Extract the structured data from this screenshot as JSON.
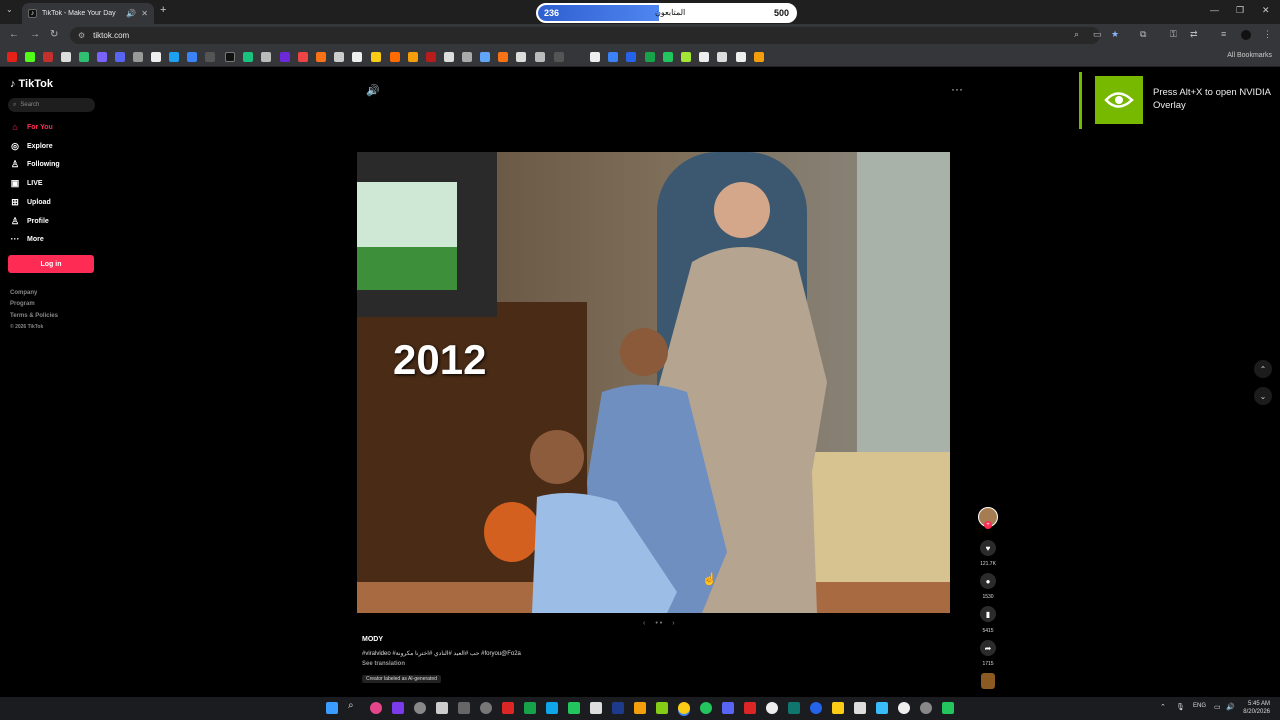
{
  "browser": {
    "tab_title": "TikTok - Make Your Day",
    "url": "tiktok.com",
    "all_bookmarks": "All Bookmarks"
  },
  "overlay_progress": {
    "current": "236",
    "label": "المتابعون",
    "max": "500",
    "fraction": 0.472
  },
  "sidebar": {
    "logo": "TikTok",
    "search_placeholder": "Search",
    "items": [
      {
        "label": "For You",
        "icon": "home-icon",
        "active": true
      },
      {
        "label": "Explore",
        "icon": "compass-icon"
      },
      {
        "label": "Following",
        "icon": "user-icon"
      },
      {
        "label": "LIVE",
        "icon": "live-icon"
      },
      {
        "label": "Upload",
        "icon": "upload-icon"
      },
      {
        "label": "Profile",
        "icon": "profile-icon"
      },
      {
        "label": "More",
        "icon": "more-icon"
      }
    ],
    "login": "Log in",
    "footer": [
      "Company",
      "Program",
      "Terms & Policies",
      "© 2026 TikTok"
    ]
  },
  "post": {
    "year_overlay": "2012",
    "author": "MODY",
    "caption": "#viralvideo #حب #العيد #النادي #اخترنا مكرونة #foryou@Fo2a",
    "see_translation": "See translation",
    "ai_label": "Creator labeled as AI-generated",
    "likes": "121.7K",
    "comments": "1530",
    "saves": "5415",
    "shares": "1715"
  },
  "nvidia_overlay": {
    "message": "Press Alt+X to open NVIDIA Overlay"
  },
  "system": {
    "lang": "ENG",
    "time": "5:45 AM",
    "date": "8/20/2026"
  }
}
